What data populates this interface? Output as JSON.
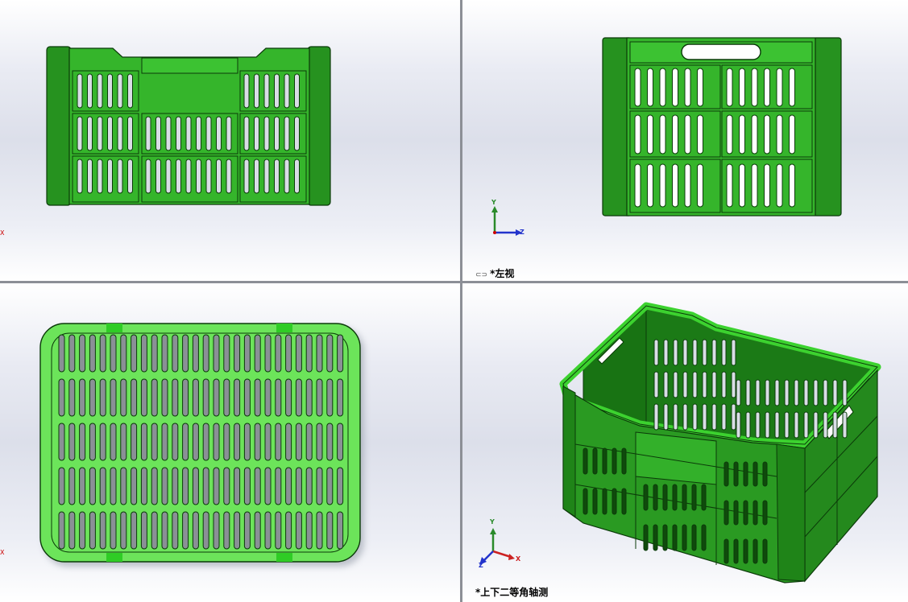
{
  "viewports": {
    "front": {
      "label": ""
    },
    "left": {
      "label_prefix": "*",
      "label": "左视"
    },
    "top": {
      "label": ""
    },
    "iso": {
      "label_prefix": "*",
      "label": "上下二等角轴测"
    }
  },
  "axes": {
    "x": "X",
    "y": "Y",
    "z": "Z"
  },
  "colors": {
    "body": "#2a9a22",
    "dark": "#11600f",
    "edge": "#0b3a09",
    "light": "#5fe04f",
    "bottom": "#6ce45a"
  }
}
